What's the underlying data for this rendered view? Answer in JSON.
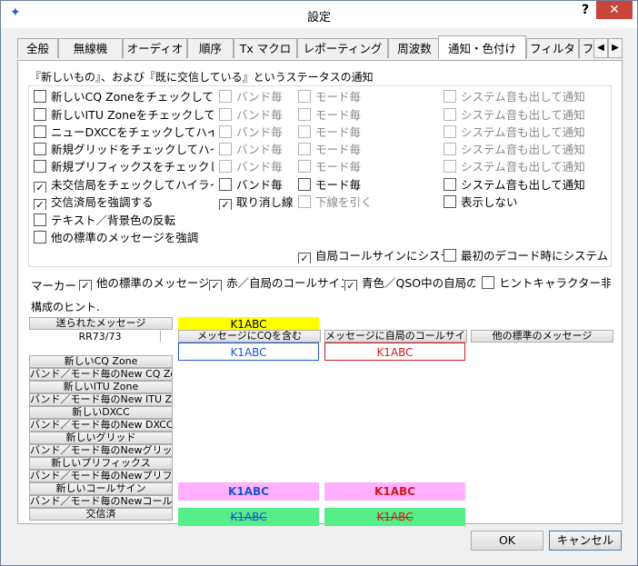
{
  "window": {
    "title": "設定",
    "help": "?",
    "close": "✕",
    "icon": "star-icon"
  },
  "tabs": [
    "全般",
    "無線機",
    "オーディオ",
    "順序",
    "Tx マクロ",
    "レポーティング",
    "周波数",
    "通知・色付け",
    "フィルタ",
    "フ"
  ],
  "tab_scroll": {
    "left": "◀",
    "right": "▶"
  },
  "group": {
    "title": "『新しいもの』、および『既に交信している』というステータスの通知",
    "rows": [
      {
        "main": "新しいCQ Zoneをチェックして強調表",
        "main_checked": false,
        "band": "バンド毎",
        "mode": "モード毎",
        "sound": "システム音も出して通知"
      },
      {
        "main": "新しいITU Zoneをチェックして強調表",
        "main_checked": false,
        "band": "バンド毎",
        "mode": "モード毎",
        "sound": "システム音も出して通知"
      },
      {
        "main": "ニューDXCCをチェックしてハイライト表",
        "main_checked": false,
        "band": "バンド毎",
        "mode": "モード毎",
        "sound": "システム音も出して通知"
      },
      {
        "main": "新規グリッドをチェックしてハイライト表",
        "main_checked": false,
        "band": "バンド毎",
        "mode": "モード毎",
        "sound": "システム音も出して通知"
      },
      {
        "main": "新規プリフィックスをチェックしてハイラ",
        "main_checked": false,
        "band": "バンド毎",
        "mode": "モード毎",
        "sound": "システム音も出して通知"
      },
      {
        "main": "未交信局をチェックしてハイライトを行",
        "main_checked": true,
        "band": "バンド毎",
        "mode": "モード毎",
        "sound": "システム音も出して通知"
      }
    ],
    "worked": {
      "label": "交信済局を強調する",
      "strike": "取り消し線",
      "underline": "下線を引く",
      "hide": "表示しない"
    },
    "invert": "テキスト／背景色の反転",
    "other_emph": "他の標準のメッセージを強調",
    "own_call_sound": "自局コールサインにシステム音",
    "first_decode_sound": "最初のデコード時にシステム音"
  },
  "marker": {
    "label": "マーカー",
    "other_std": "他の標準のメッセージ",
    "red_own": "赤／自局のコールサイン",
    "blue_qso": "青色／QSO中の自局の",
    "hint_hide": "ヒントキャラクター非表示"
  },
  "hints": {
    "title": "構成のヒント.",
    "sent_msg": "送られたメッセージ",
    "rr": "RR73/73",
    "left_buttons": [
      "新しいCQ Zone",
      "バンド／モード毎のNew CQ Zone",
      "新しいITU Zone",
      "バンド／モード毎のNew ITU Zone",
      "新しいDXCC",
      "バンド／モード毎のNew DXCC",
      "新しいグリッド",
      "バンド／モード毎のNewグリッド",
      "新しいプリフィックス",
      "バンド／モード毎のNewプリフィックス",
      "新しいコールサイン",
      "バンド／モード毎のNewコールサイン",
      "交信済"
    ],
    "col_buttons": [
      "メッセージにCQを含む",
      "メッセージに自局のコールサイン",
      "他の標準のメッセージ"
    ],
    "call": "K1ABC"
  },
  "buttons": {
    "ok": "OK",
    "cancel": "キャンセル"
  },
  "colors": {
    "yellow": "#ffff00",
    "blue": "#1a55d0",
    "red": "#d01a1a",
    "pink": "#ffb0ff",
    "green": "#55ee88",
    "tab_border": "#adadad"
  }
}
